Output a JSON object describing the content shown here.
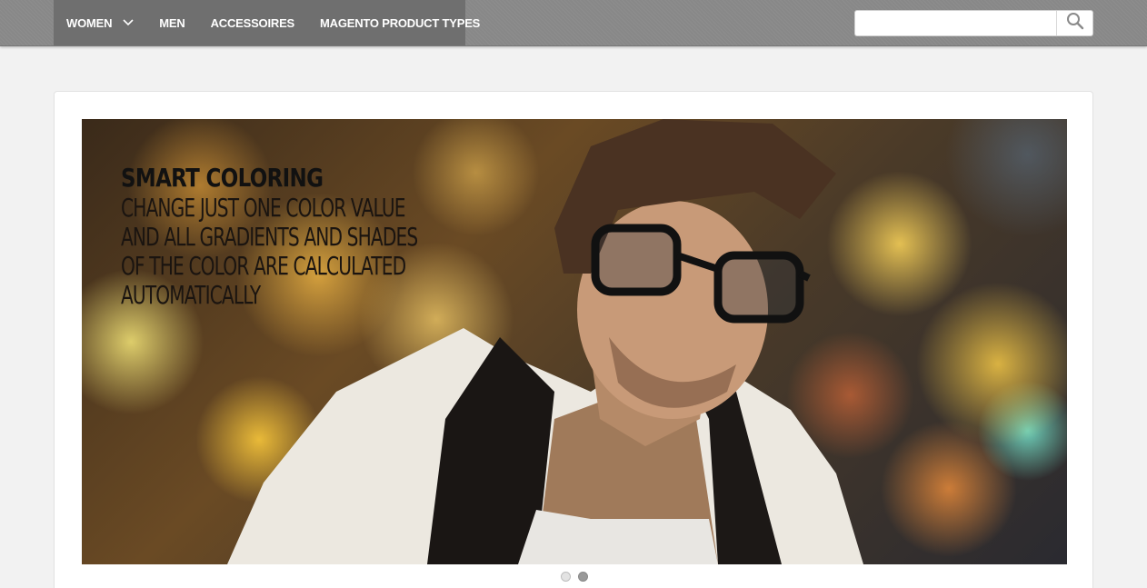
{
  "nav": {
    "items": [
      {
        "label": "WOMEN",
        "has_dropdown": true
      },
      {
        "label": "MEN",
        "has_dropdown": false
      },
      {
        "label": "ACCESSOIRES",
        "has_dropdown": false
      },
      {
        "label": "MAGENTO PRODUCT TYPES",
        "has_dropdown": false
      }
    ]
  },
  "search": {
    "value": "",
    "placeholder": "",
    "button_icon": "search-icon"
  },
  "slider": {
    "title": "SMART COLORING",
    "body_lines": [
      "CHANGE JUST ONE COLOR VALUE",
      "AND ALL GRADIENTS AND SHADES",
      "OF THE COLOR ARE CALCULATED",
      "AUTOMATICALLY"
    ],
    "slide_count": 2,
    "active_slide": 2
  },
  "colors": {
    "topbar": "#888888",
    "nav_background": "#6f6f6f",
    "page_background": "#f2f2f2",
    "active_dot": "#999999"
  }
}
